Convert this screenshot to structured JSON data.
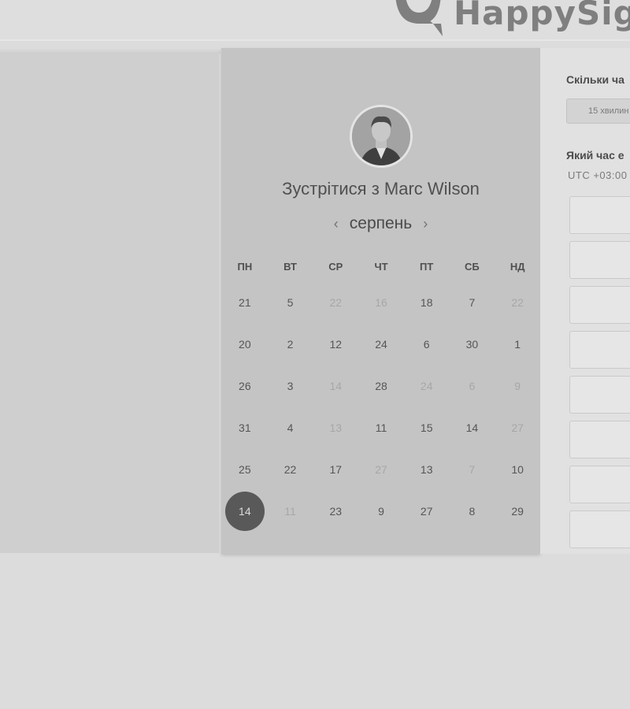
{
  "brand": {
    "name": "HappySig"
  },
  "calendar": {
    "title": "Зустрітися з Marc Wilson",
    "month": "серпень",
    "prev_icon": "chevron-left-icon",
    "next_icon": "chevron-right-icon",
    "weekdays": [
      "ПН",
      "ВТ",
      "СР",
      "ЧТ",
      "ПТ",
      "СБ",
      "НД"
    ],
    "weeks": [
      [
        {
          "d": "21",
          "off": false
        },
        {
          "d": "5",
          "off": false
        },
        {
          "d": "22",
          "off": true
        },
        {
          "d": "16",
          "off": true
        },
        {
          "d": "18",
          "off": false
        },
        {
          "d": "7",
          "off": false
        },
        {
          "d": "22",
          "off": true
        }
      ],
      [
        {
          "d": "20",
          "off": false
        },
        {
          "d": "2",
          "off": false
        },
        {
          "d": "12",
          "off": false
        },
        {
          "d": "24",
          "off": false
        },
        {
          "d": "6",
          "off": false
        },
        {
          "d": "30",
          "off": false
        },
        {
          "d": "1",
          "off": false
        }
      ],
      [
        {
          "d": "26",
          "off": false
        },
        {
          "d": "3",
          "off": false
        },
        {
          "d": "14",
          "off": true
        },
        {
          "d": "28",
          "off": false
        },
        {
          "d": "24",
          "off": true
        },
        {
          "d": "6",
          "off": true
        },
        {
          "d": "9",
          "off": true
        }
      ],
      [
        {
          "d": "31",
          "off": false
        },
        {
          "d": "4",
          "off": false
        },
        {
          "d": "13",
          "off": true
        },
        {
          "d": "11",
          "off": false
        },
        {
          "d": "15",
          "off": false
        },
        {
          "d": "14",
          "off": false
        },
        {
          "d": "27",
          "off": true
        }
      ],
      [
        {
          "d": "25",
          "off": false
        },
        {
          "d": "22",
          "off": false
        },
        {
          "d": "17",
          "off": false
        },
        {
          "d": "27",
          "off": true
        },
        {
          "d": "13",
          "off": false
        },
        {
          "d": "7",
          "off": true
        },
        {
          "d": "10",
          "off": false
        }
      ],
      [
        {
          "d": "14",
          "off": false,
          "selected": true
        },
        {
          "d": "11",
          "off": true
        },
        {
          "d": "23",
          "off": false
        },
        {
          "d": "9",
          "off": false
        },
        {
          "d": "27",
          "off": false
        },
        {
          "d": "8",
          "off": false
        },
        {
          "d": "29",
          "off": false
        }
      ]
    ]
  },
  "booking": {
    "duration_question": "Скільки ча",
    "duration_value": "15 хвилин",
    "time_question": "Який час е",
    "timezone": "UTC +03:00"
  },
  "colors": {
    "selected_day": "#595959",
    "card_bg": "#c4c4c4",
    "panel_bg": "#e1e1e1"
  }
}
